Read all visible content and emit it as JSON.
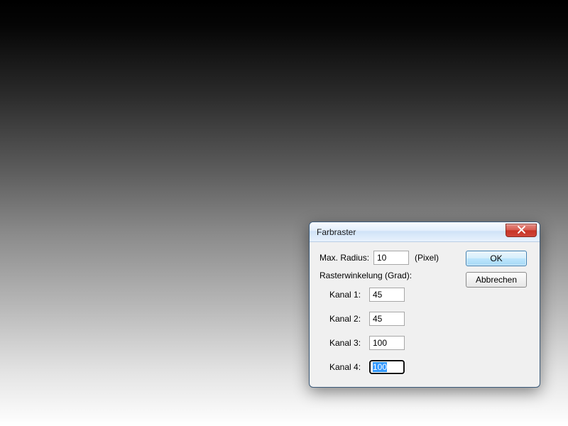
{
  "dialog": {
    "title": "Farbraster",
    "maxRadiusLabel": "Max. Radius:",
    "maxRadiusValue": "10",
    "unit": "(Pixel)",
    "subHeader": "Rasterwinkelung (Grad):",
    "channels": [
      {
        "label": "Kanal 1:",
        "value": "45"
      },
      {
        "label": "Kanal 2:",
        "value": "45"
      },
      {
        "label": "Kanal 3:",
        "value": "100"
      },
      {
        "label": "Kanal 4:",
        "value": "100"
      }
    ],
    "okLabel": "OK",
    "cancelLabel": "Abbrechen"
  }
}
